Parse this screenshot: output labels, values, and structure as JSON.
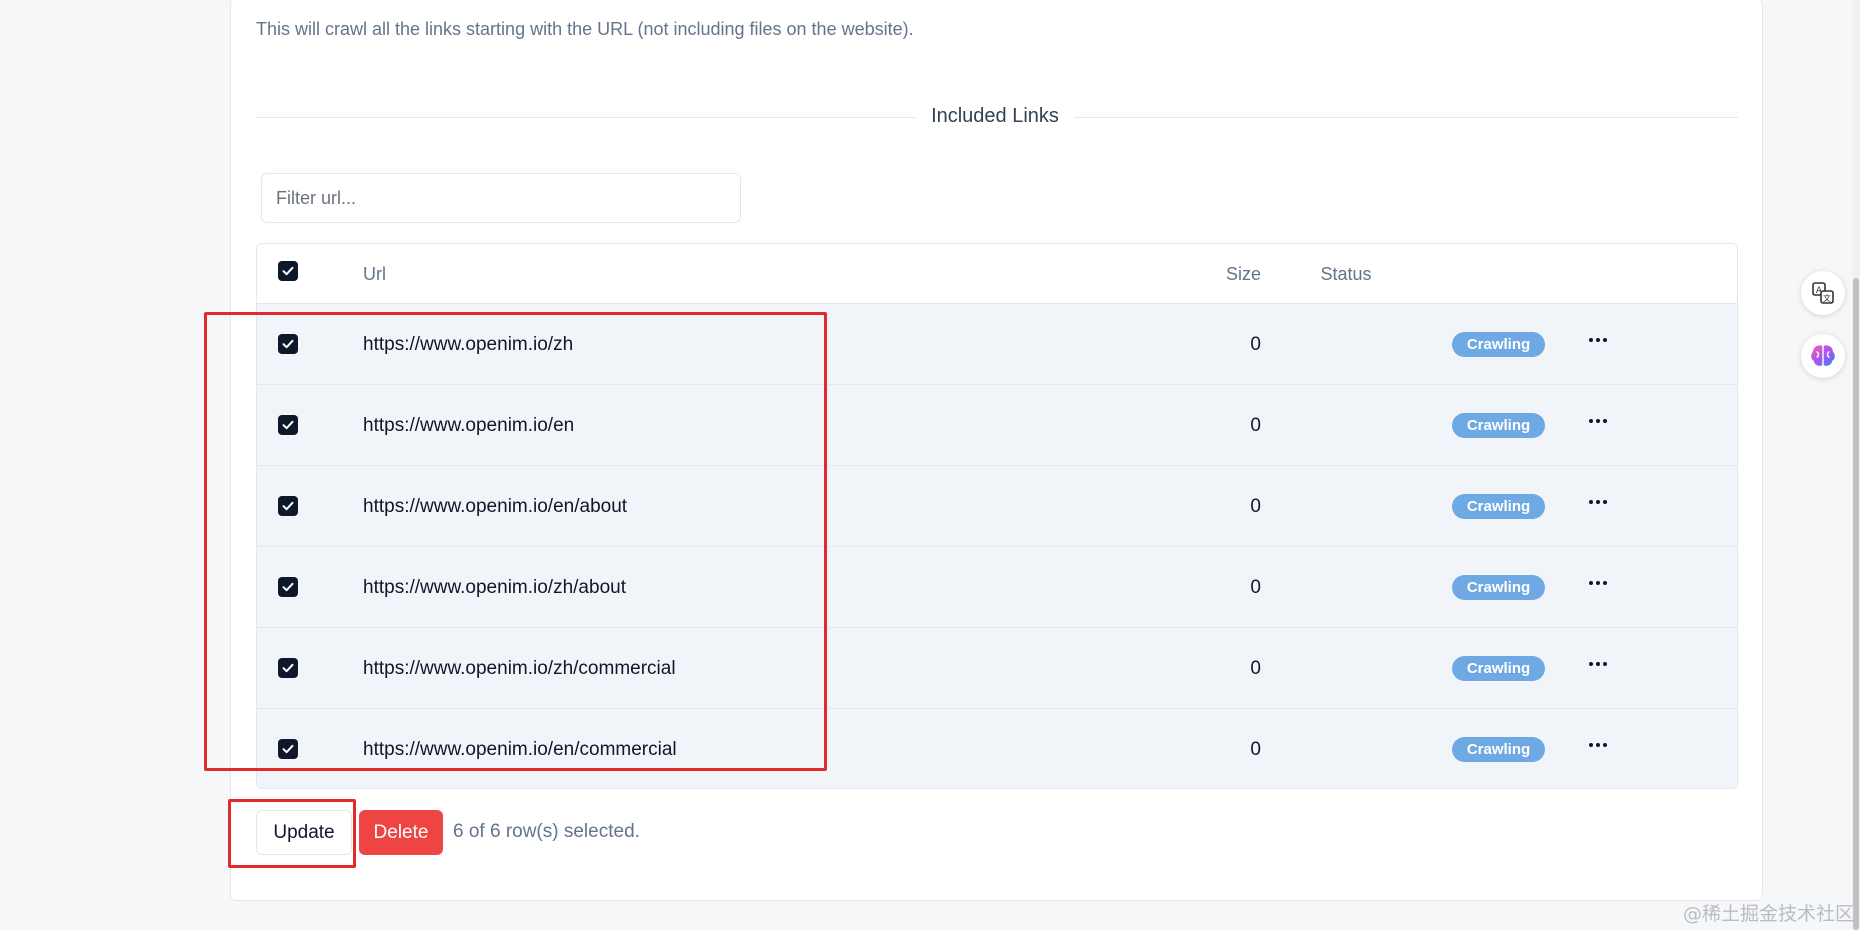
{
  "description": "This will crawl all the links starting with the URL (not including files on the website).",
  "section_title": "Included Links",
  "filter": {
    "placeholder": "Filter url...",
    "value": ""
  },
  "table": {
    "headers": {
      "url": "Url",
      "size": "Size",
      "status": "Status"
    },
    "rows": [
      {
        "url": "https://www.openim.io/zh",
        "size": "0",
        "status": "Crawling",
        "checked": true
      },
      {
        "url": "https://www.openim.io/en",
        "size": "0",
        "status": "Crawling",
        "checked": true
      },
      {
        "url": "https://www.openim.io/en/about",
        "size": "0",
        "status": "Crawling",
        "checked": true
      },
      {
        "url": "https://www.openim.io/zh/about",
        "size": "0",
        "status": "Crawling",
        "checked": true
      },
      {
        "url": "https://www.openim.io/zh/commercial",
        "size": "0",
        "status": "Crawling",
        "checked": true
      },
      {
        "url": "https://www.openim.io/en/commercial",
        "size": "0",
        "status": "Crawling",
        "checked": true
      }
    ]
  },
  "actions": {
    "update_label": "Update",
    "delete_label": "Delete"
  },
  "selection_status": "6 of 6 row(s) selected.",
  "watermark": "@稀土掘金技术社区",
  "colors": {
    "badge": "#6fa9e3",
    "delete": "#ef4444",
    "highlight": "#e02b2b",
    "checkbox": "#0f172a"
  },
  "icons": {
    "checkbox": "check-icon",
    "row_menu": "more-horizontal-icon",
    "float_1": "translate-icon",
    "float_2": "brain-icon"
  }
}
